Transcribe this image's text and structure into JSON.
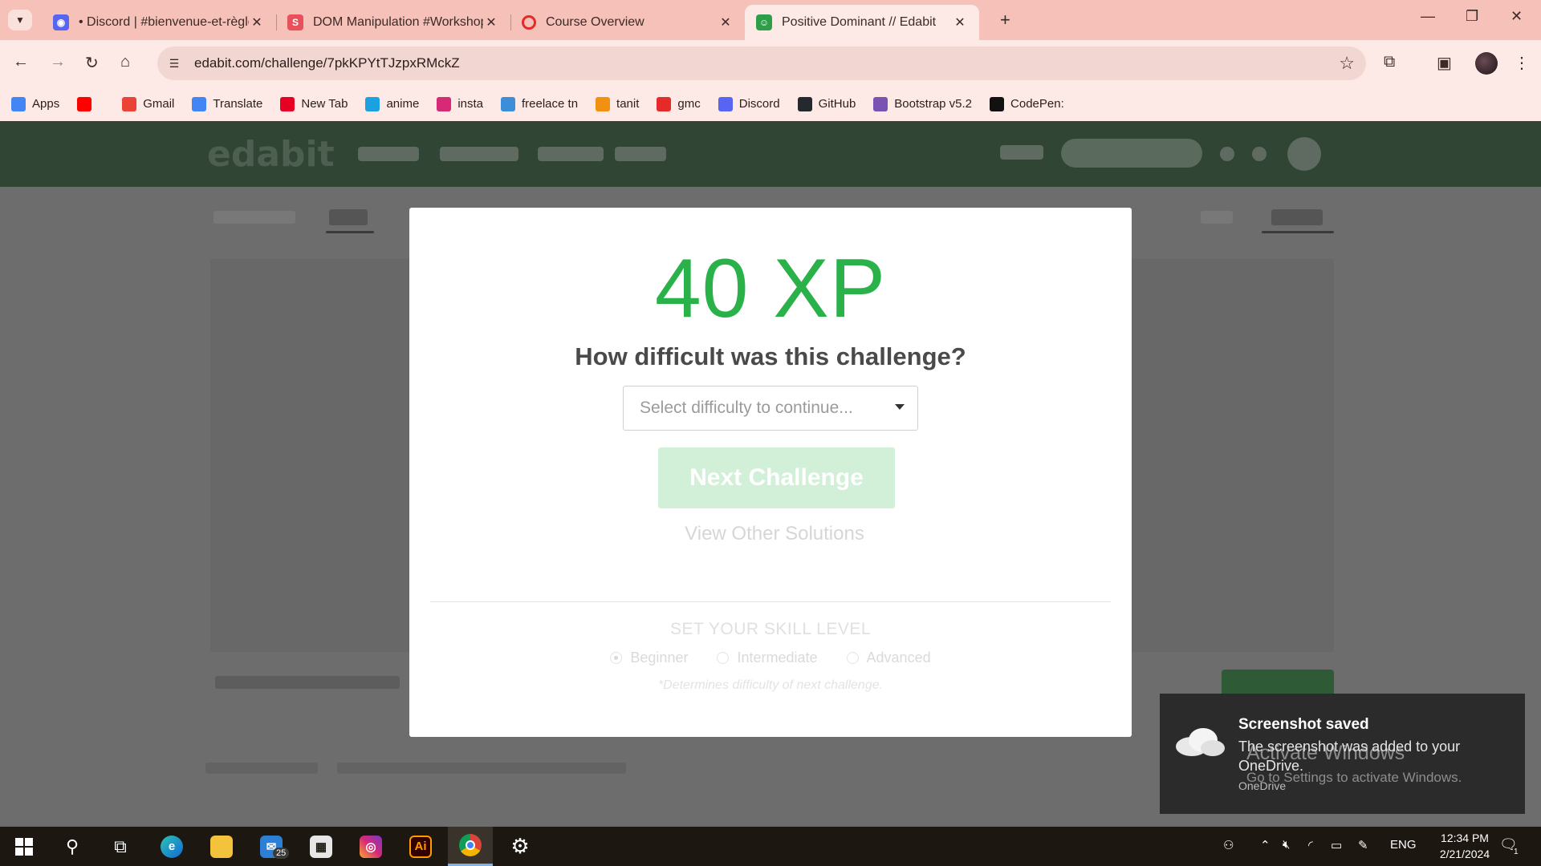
{
  "browser": {
    "tabs": [
      {
        "title": "• Discord | #bienvenue-et-règle",
        "favicon": "discord-icon",
        "color": "#5865f2",
        "active": false
      },
      {
        "title": "DOM Manipulation #Workshop",
        "favicon": "s-icon",
        "color": "#e8505b",
        "active": false
      },
      {
        "title": "Course Overview",
        "favicon": "red-ring-icon",
        "color": "#e52a2a",
        "active": false
      },
      {
        "title": "Positive Dominant // Edabit",
        "favicon": "edabit-icon",
        "color": "#2e9e48",
        "active": true
      }
    ],
    "url": "edabit.com/challenge/7pkKPYtTJzpxRMckZ",
    "bookmarks": [
      {
        "label": "Apps",
        "icon": "apps-grid-icon",
        "color": "#4285f4"
      },
      {
        "label": "",
        "icon": "youtube-icon",
        "color": "#ff0000"
      },
      {
        "label": "Gmail",
        "icon": "gmail-icon",
        "color": "#ea4335"
      },
      {
        "label": "Translate",
        "icon": "translate-icon",
        "color": "#4285f4"
      },
      {
        "label": "New Tab",
        "icon": "pinterest-icon",
        "color": "#e60023"
      },
      {
        "label": "anime",
        "icon": "anime-icon",
        "color": "#1ba1e2"
      },
      {
        "label": "insta",
        "icon": "instagram-icon",
        "color": "#d62976"
      },
      {
        "label": "freelace tn",
        "icon": "freelance-icon",
        "color": "#3a8fd8"
      },
      {
        "label": "tanit",
        "icon": "tanit-icon",
        "color": "#f29111"
      },
      {
        "label": "gmc",
        "icon": "gmc-icon",
        "color": "#e52a2a"
      },
      {
        "label": "Discord",
        "icon": "discord-icon",
        "color": "#5865f2"
      },
      {
        "label": "GitHub",
        "icon": "github-icon",
        "color": "#24292e"
      },
      {
        "label": "Bootstrap v5.2",
        "icon": "bootstrap-icon",
        "color": "#7952b3"
      },
      {
        "label": "CodePen:",
        "icon": "codepen-icon",
        "color": "#111111"
      }
    ]
  },
  "modal": {
    "xp": "40 XP",
    "question": "How difficult was this challenge?",
    "select_placeholder": "Select difficulty to continue...",
    "next_button": "Next Challenge",
    "view_solutions": "View Other Solutions",
    "skill_title": "SET YOUR SKILL LEVEL",
    "skill_levels": [
      {
        "label": "Beginner",
        "selected": true
      },
      {
        "label": "Intermediate",
        "selected": false
      },
      {
        "label": "Advanced",
        "selected": false
      }
    ],
    "note": "*Determines difficulty of next challenge."
  },
  "site": {
    "logo": "edabit"
  },
  "toast": {
    "title": "Screenshot saved",
    "body": "The screenshot was added to your OneDrive.",
    "source": "OneDrive"
  },
  "watermark": {
    "line1": "Activate Windows",
    "line2": "Go to Settings to activate Windows."
  },
  "taskbar": {
    "mail_badge": "25",
    "language": "ENG",
    "time": "12:34 PM",
    "date": "2/21/2024",
    "notification_count": "1"
  },
  "colors": {
    "xp_green": "#2bb14a",
    "tabstrip": "#f6c1b8",
    "toolbar": "#fde9e5",
    "edabit_header": "#304533"
  }
}
